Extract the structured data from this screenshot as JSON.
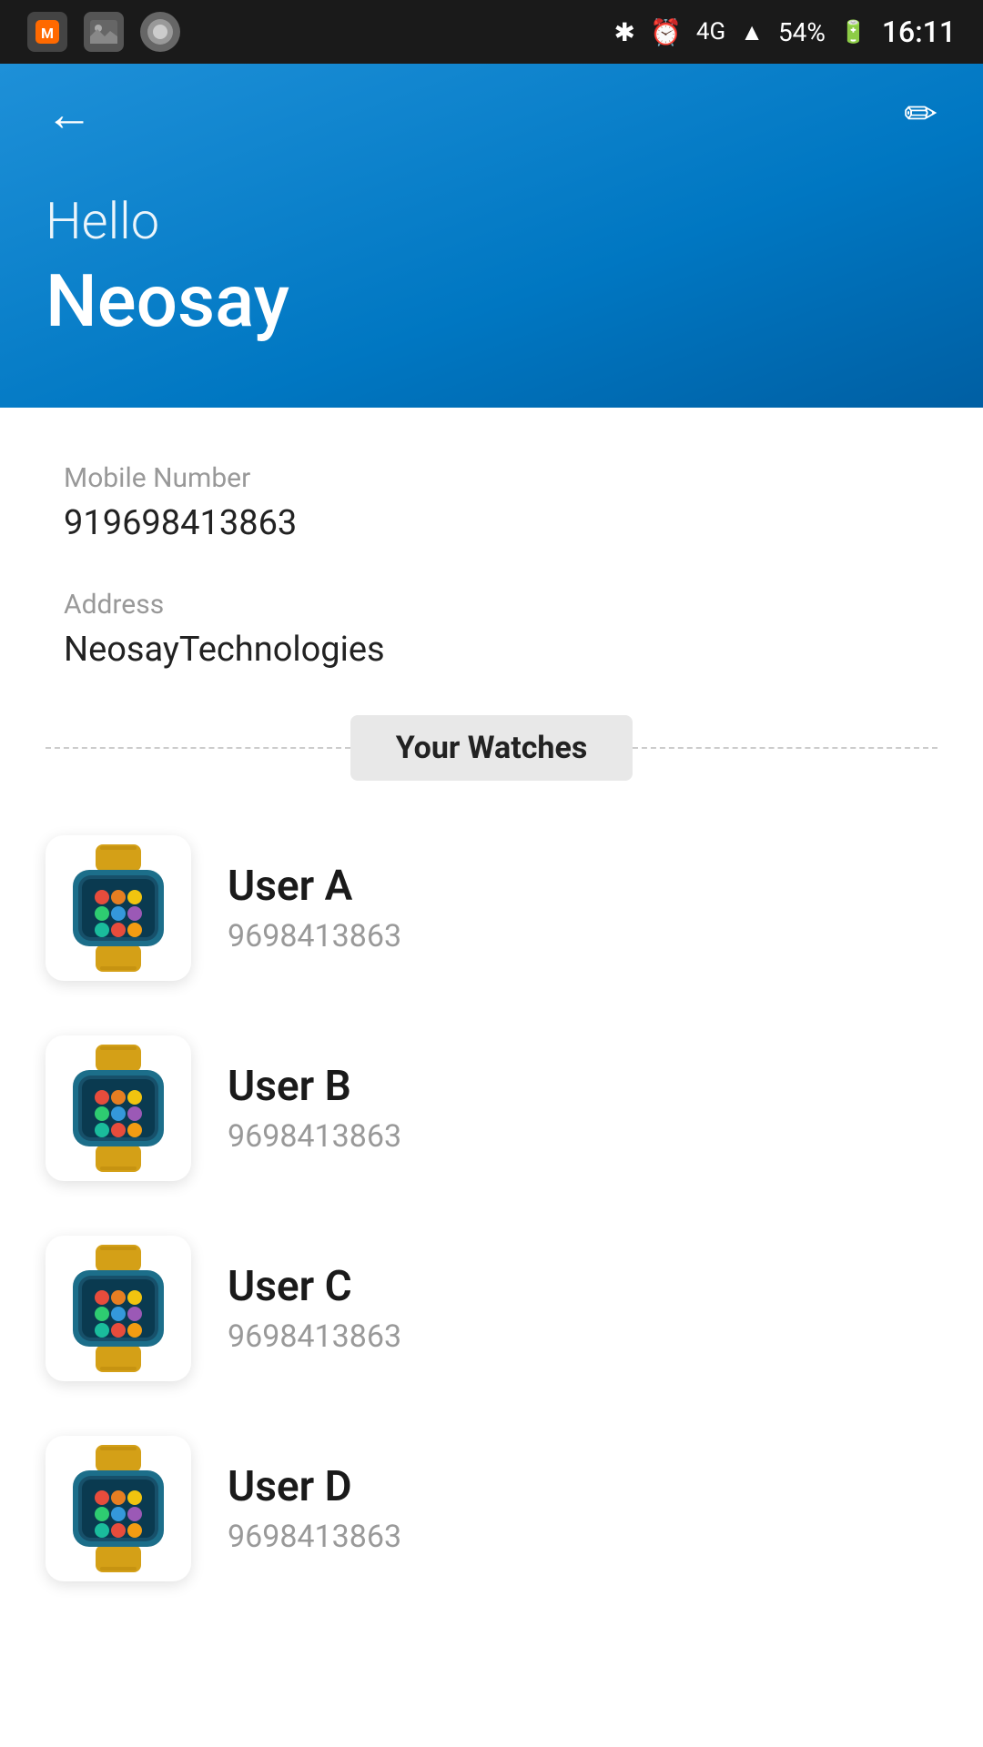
{
  "statusBar": {
    "time": "16:11",
    "battery": "54%",
    "network": "4G",
    "icons": [
      "mi-icon",
      "gallery-icon",
      "assistant-icon"
    ]
  },
  "header": {
    "backLabel": "←",
    "editLabel": "✏",
    "greeting": "Hello",
    "username": "Neosay"
  },
  "profile": {
    "mobileLabel": "Mobile Number",
    "mobileValue": "919698413863",
    "addressLabel": "Address",
    "addressValue": "NeosayTechnologies"
  },
  "watchesSection": {
    "dividerLabel": "Your Watches"
  },
  "watches": [
    {
      "name": "User A",
      "phone": "9698413863"
    },
    {
      "name": "User B",
      "phone": "9698413863"
    },
    {
      "name": "User C",
      "phone": "9698413863"
    },
    {
      "name": "User D",
      "phone": "9698413863"
    }
  ]
}
